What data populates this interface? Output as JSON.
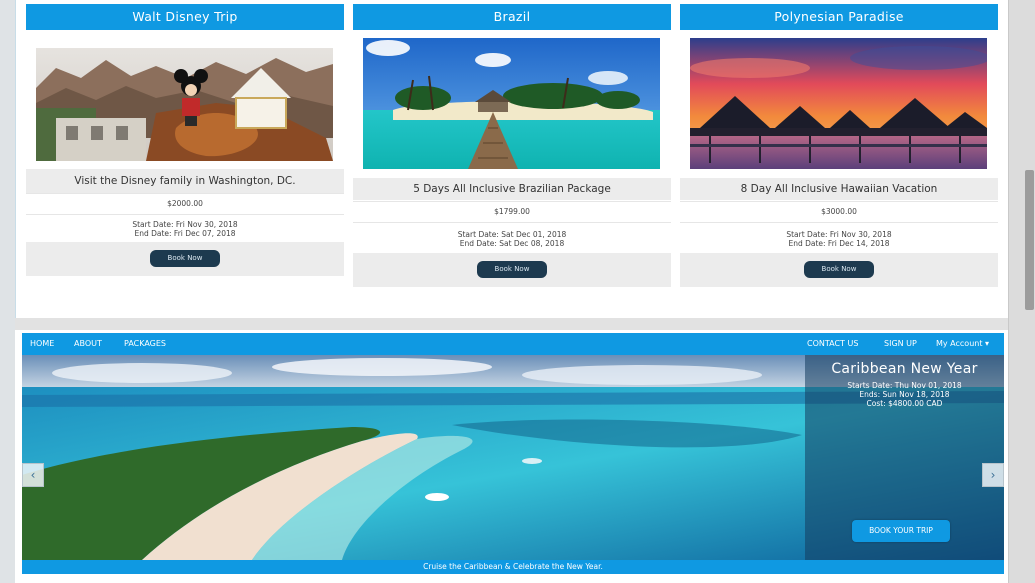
{
  "packages": [
    {
      "header": "Walt Disney Trip",
      "title": "Visit the Disney family in Washington, DC.",
      "price": "$2000.00",
      "start": "Start Date: Fri Nov 30, 2018",
      "end": "End Date: Fri Dec 07, 2018",
      "book_label": "Book Now"
    },
    {
      "header": "Brazil",
      "title": "5 Days All Inclusive Brazilian Package",
      "price": "$1799.00",
      "start": "Start Date: Sat Dec 01, 2018",
      "end": "End Date: Sat Dec 08, 2018",
      "book_label": "Book Now"
    },
    {
      "header": "Polynesian Paradise",
      "title": "8 Day All Inclusive Hawaiian Vacation",
      "price": "$3000.00",
      "start": "Start Date: Fri Nov 30, 2018",
      "end": "End Date: Fri Dec 14, 2018",
      "book_label": "Book Now"
    }
  ],
  "nav": {
    "home": "HOME",
    "about": "ABOUT",
    "packages": "PACKAGES",
    "contact": "CONTACT US",
    "signup": "SIGN UP",
    "account": "My Account"
  },
  "hero": {
    "title": "Caribbean New Year",
    "starts": "Starts Date: Thu Nov 01, 2018",
    "ends": "Ends: Sun Nov 18, 2018",
    "cost": "Cost: $4800.00 CAD",
    "book_label": "BOOK YOUR TRIP",
    "caption": "Cruise the Caribbean & Celebrate the New Year.",
    "prev_icon": "‹",
    "next_icon": "›",
    "account_caret": "▾"
  },
  "colors": {
    "brand_blue": "#0f99e2",
    "button_dark": "#1d3a4f",
    "panel_grey": "#ececec"
  }
}
